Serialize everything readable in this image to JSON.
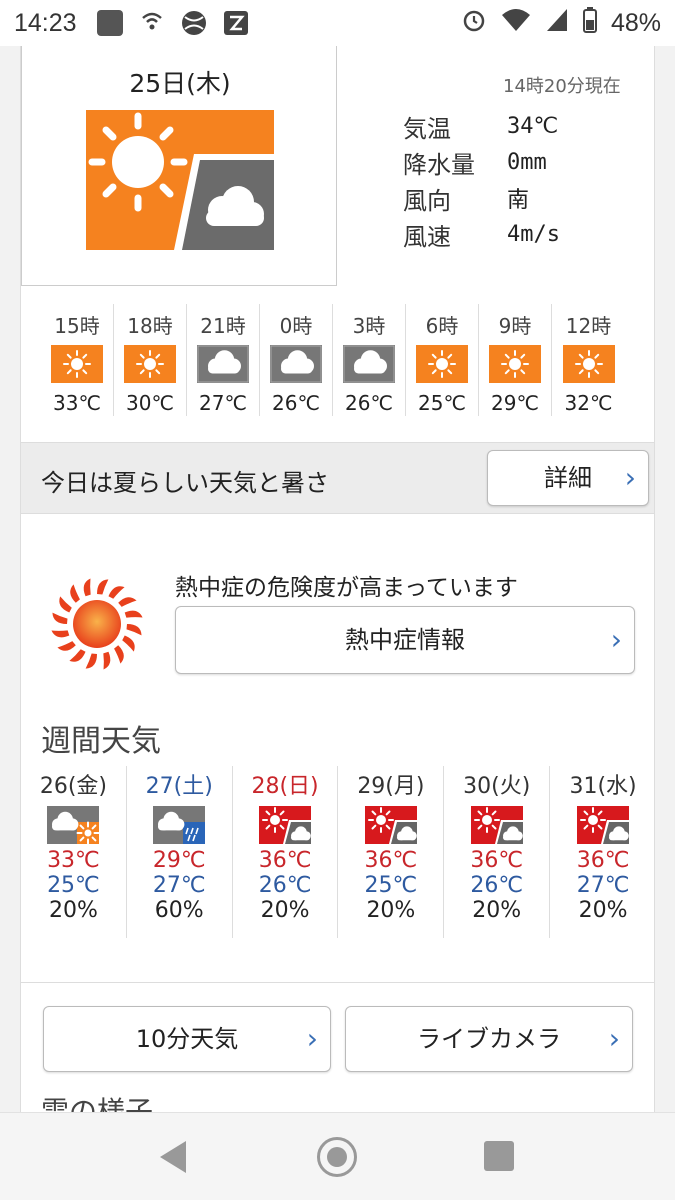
{
  "statusbar": {
    "time": "14:23",
    "battery": "48%"
  },
  "current": {
    "date": "25日(木)",
    "as_of": "14時20分現在",
    "icon": "sunny-then-cloudy-icon",
    "stats": [
      {
        "label": "気温",
        "value": "34℃"
      },
      {
        "label": "降水量",
        "value": "0mm"
      },
      {
        "label": "風向",
        "value": "南"
      },
      {
        "label": "風速",
        "value": "4m/s"
      }
    ]
  },
  "hourly": [
    {
      "time": "15時",
      "icon": "sunny",
      "temp": "33℃"
    },
    {
      "time": "18時",
      "icon": "sunny",
      "temp": "30℃"
    },
    {
      "time": "21時",
      "icon": "cloudy",
      "temp": "27℃"
    },
    {
      "time": "0時",
      "icon": "cloudy",
      "temp": "26℃"
    },
    {
      "time": "3時",
      "icon": "cloudy",
      "temp": "26℃"
    },
    {
      "time": "6時",
      "icon": "sunny",
      "temp": "25℃"
    },
    {
      "time": "9時",
      "icon": "sunny",
      "temp": "29℃"
    },
    {
      "time": "12時",
      "icon": "sunny",
      "temp": "32℃"
    }
  ],
  "summary": {
    "text": "今日は夏らしい天気と暑さ",
    "button": "詳細"
  },
  "heatstroke": {
    "text": "熱中症の危険度が高まっています",
    "button": "熱中症情報"
  },
  "weekly": {
    "title": "週間天気",
    "days": [
      {
        "label": "26(金)",
        "label_color": "#333333",
        "icon": "cloudy-sunny",
        "max": "33℃",
        "min": "25℃",
        "pop": "20%"
      },
      {
        "label": "27(土)",
        "label_color": "#2e5aa0",
        "icon": "cloudy-rain",
        "max": "29℃",
        "min": "27℃",
        "pop": "60%"
      },
      {
        "label": "28(日)",
        "label_color": "#c8262b",
        "icon": "hot-cloudy",
        "max": "36℃",
        "min": "26℃",
        "pop": "20%"
      },
      {
        "label": "29(月)",
        "label_color": "#333333",
        "icon": "hot-cloudy",
        "max": "36℃",
        "min": "25℃",
        "pop": "20%"
      },
      {
        "label": "30(火)",
        "label_color": "#333333",
        "icon": "hot-cloudy",
        "max": "36℃",
        "min": "26℃",
        "pop": "20%"
      },
      {
        "label": "31(水)",
        "label_color": "#333333",
        "icon": "hot-cloudy",
        "max": "36℃",
        "min": "27℃",
        "pop": "20%"
      }
    ]
  },
  "buttons": {
    "ten_min": "10分天気",
    "live_camera": "ライブカメラ"
  },
  "cloud_heading": "雲の様子",
  "colors": {
    "sunny": "#f5821f",
    "hot": "#d7191d",
    "cloudy": "#666666",
    "rain": "#2a65b8"
  }
}
